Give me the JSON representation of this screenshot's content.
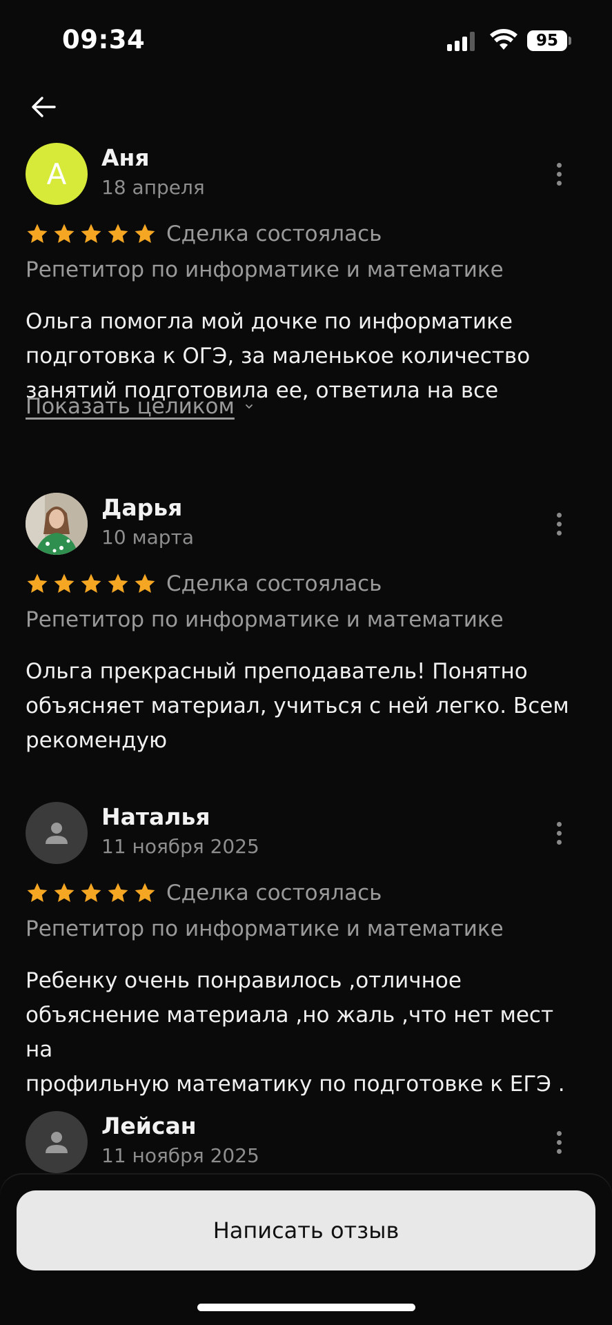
{
  "status_bar": {
    "time": "09:34",
    "battery": "95"
  },
  "colors": {
    "background": "#0a0a0a",
    "star": "#f5a623",
    "secondary_text": "#9a9a9a",
    "button_bg": "#e8e8e8"
  },
  "icons": {
    "back": "arrow-left-icon",
    "more": "more-vertical-icon",
    "star": "star-icon",
    "chevron": "chevron-down-icon",
    "user_placeholder": "user-placeholder-icon"
  },
  "reviews": [
    {
      "avatar_letter": "А",
      "author": "Аня",
      "date": "18 апреля",
      "rating": 5,
      "deal_status": "Сделка состоялась",
      "service": "Репетитор по информатике и математике",
      "text": "Ольга помогла мой дочке по информатике\nподготовка к ОГЭ, за маленькое количество\nзанятий  подготовила ее, ответила на все",
      "show_more": "Показать целиком"
    },
    {
      "author": "Дарья",
      "date": "10 марта",
      "rating": 5,
      "deal_status": "Сделка состоялась",
      "service": "Репетитор по информатике и математике",
      "text": "Ольга прекрасный преподаватель! Понятно\nобъясняет материал, учиться с ней легко. Всем\nрекомендую"
    },
    {
      "author": "Наталья",
      "date": "11 ноября 2025",
      "rating": 5,
      "deal_status": "Сделка состоялась",
      "service": "Репетитор по информатике и математике",
      "text": "Ребенку очень понравилось ,отличное\nобъяснение материала ,но жаль ,что нет мест на\nпрофильную математику по подготовке к ЕГЭ ."
    },
    {
      "author": "Лейсан",
      "date": "11 ноября 2025"
    }
  ],
  "write_review_label": "Написать отзыв"
}
